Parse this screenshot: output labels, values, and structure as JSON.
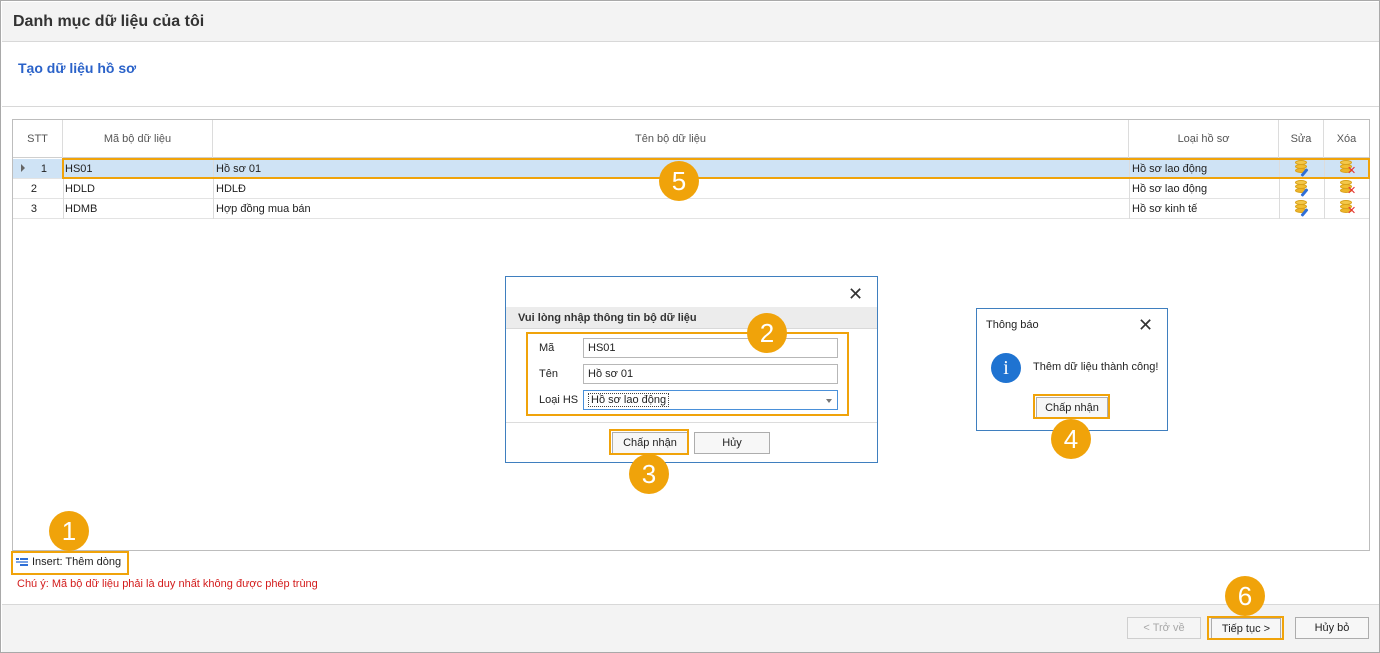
{
  "window": {
    "title": "Danh mục dữ liệu của tôi"
  },
  "subtitle": "Tạo dữ liệu hồ sơ",
  "grid": {
    "columns": [
      "STT",
      "Mã bộ dữ liệu",
      "Tên bộ dữ liệu",
      "Loại hồ sơ",
      "Sửa",
      "Xóa"
    ],
    "rows": [
      {
        "stt": "1",
        "ma": "HS01",
        "ten": "Hồ sơ 01",
        "loai": "Hồ sơ lao động",
        "selected": true
      },
      {
        "stt": "2",
        "ma": "HDLD",
        "ten": "HDLĐ",
        "loai": "Hồ sơ lao động",
        "selected": false
      },
      {
        "stt": "3",
        "ma": "HDMB",
        "ten": "Hợp đồng mua bán",
        "loai": "Hồ sơ kinh tế",
        "selected": false
      }
    ],
    "edit_icon": "database-edit-icon",
    "delete_icon": "database-delete-icon"
  },
  "insert_label": "Insert: Thêm dòng",
  "note": "Chú ý: Mã bộ dữ liệu phải là duy nhất không được phép trùng",
  "input_dialog": {
    "close": "✕",
    "heading": "Vui lòng nhập thông tin bộ dữ liệu",
    "ma_label": "Mã",
    "ma_value": "HS01",
    "ten_label": "Tên",
    "ten_value": "Hồ sơ 01",
    "loai_label": "Loại HS",
    "loai_value": "Hồ sơ lao động",
    "accept": "Chấp nhận",
    "cancel": "Hủy"
  },
  "message_box": {
    "title": "Thông báo",
    "close": "✕",
    "icon": "i",
    "message": "Thêm dữ liệu thành công!",
    "accept": "Chấp nhận"
  },
  "footer": {
    "back": "< Trở về",
    "next": "Tiếp tục >",
    "cancel": "Hủy bỏ"
  },
  "badges": [
    "1",
    "2",
    "3",
    "4",
    "5",
    "6"
  ],
  "colors": {
    "highlight": "#f0a30a",
    "accent": "#2a62c9",
    "selected_row": "#cfe3f5",
    "note": "#d31c1c"
  }
}
